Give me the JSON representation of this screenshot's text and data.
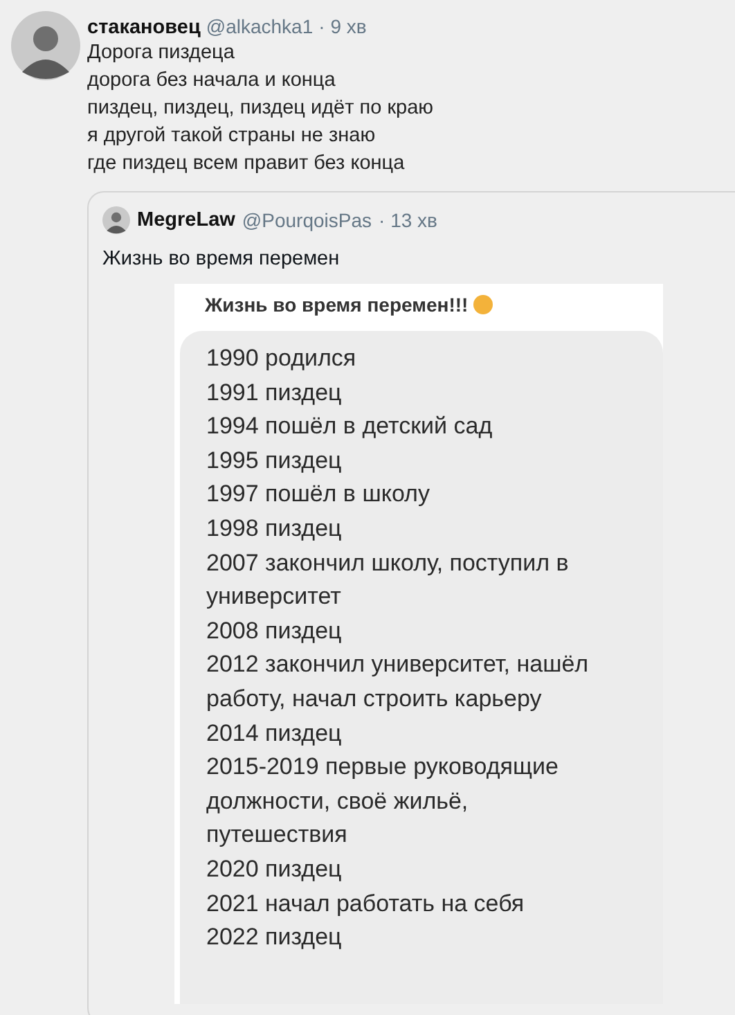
{
  "tweet": {
    "author": "стакановец",
    "handle": "@alkachka1",
    "time": "· 9 хв",
    "lines": [
      "Дорога пиздеца",
      "дорога без начала и конца",
      "пиздец, пиздец, пиздец идёт по краю",
      "я другой такой страны не знаю",
      "где пиздец всем правит без конца"
    ]
  },
  "quoted_tweet": {
    "author": "MegreLaw",
    "handle": "@PourqoisPas",
    "time": "· 13 хв",
    "text": "Жизнь во время перемен",
    "image": {
      "heading": "Жизнь во время перемен!!!",
      "entries": [
        {
          "lines": [
            "1990 родился"
          ]
        },
        {
          "lines": [
            "1991 пиздец"
          ]
        },
        {
          "lines": [
            "1994 пошёл в детский сад"
          ]
        },
        {
          "lines": [
            "1995 пиздец"
          ]
        },
        {
          "lines": [
            "1997 пошёл в школу"
          ]
        },
        {
          "lines": [
            "1998 пиздец"
          ]
        },
        {
          "lines": [
            "2007 закончил школу, поступил в",
            "университет"
          ]
        },
        {
          "lines": [
            "2008 пиздец"
          ]
        },
        {
          "lines": [
            "2012 закончил университет, нашёл",
            "работу, начал строить карьеру"
          ]
        },
        {
          "lines": [
            "2014 пиздец"
          ]
        },
        {
          "lines": [
            "2015-2019 первые руководящие",
            "должности, своё жильё,",
            "путешествия"
          ]
        },
        {
          "lines": [
            "2020 пиздец"
          ]
        },
        {
          "lines": [
            "2021 начал работать на себя"
          ]
        },
        {
          "lines": [
            "2022 пиздец"
          ]
        }
      ]
    }
  }
}
